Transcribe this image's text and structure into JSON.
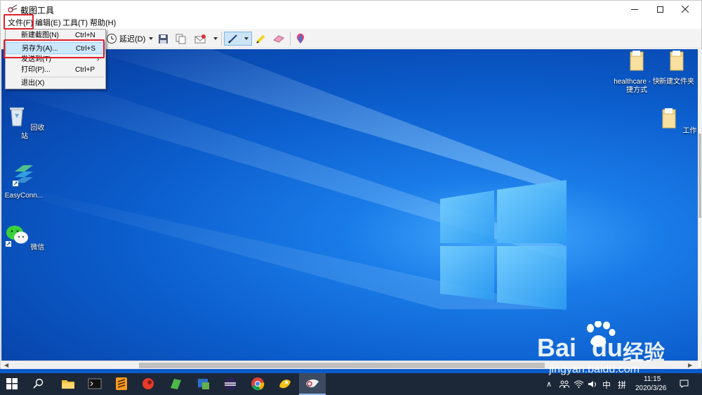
{
  "window": {
    "title": "截图工具"
  },
  "menubar": {
    "items": [
      "文件(F)",
      "编辑(E)",
      "工具(T)",
      "帮助(H)"
    ]
  },
  "toolbar": {
    "delay_label": "延迟(D)"
  },
  "file_menu": {
    "items": [
      {
        "label": "新建截图(N)",
        "shortcut": "Ctrl+N"
      },
      {
        "label": "另存为(A)...",
        "shortcut": "Ctrl+S"
      },
      {
        "label": "发送到(T)",
        "shortcut": ""
      },
      {
        "label": "打印(P)...",
        "shortcut": "Ctrl+P"
      },
      {
        "label": "退出(X)",
        "shortcut": ""
      }
    ],
    "submenu_arrow": "›"
  },
  "desktop": {
    "icons": [
      {
        "label": "回收站",
        "icon": "recycle-bin-icon"
      },
      {
        "label": "EasyConn...",
        "icon": "easyconnect-icon"
      },
      {
        "label": "微信",
        "icon": "wechat-icon"
      },
      {
        "label": "healthcare - 快捷方式",
        "icon": "folder-shortcut-icon"
      },
      {
        "label": "新建文件夹",
        "icon": "folder-icon"
      },
      {
        "label": "工作",
        "icon": "folder-icon"
      }
    ]
  },
  "taskbar": {
    "ime": "中",
    "ime2": "拼",
    "time": "11:15",
    "date": "2020/3/26"
  },
  "watermark": {
    "brand": "Bai",
    "brand2": "du",
    "brand3": "经验",
    "url": "jingyan.baidu.com"
  },
  "colors": {
    "highlight": "#cce8ff",
    "red_annotation": "#e0202a",
    "taskbar": "#1c2838"
  }
}
